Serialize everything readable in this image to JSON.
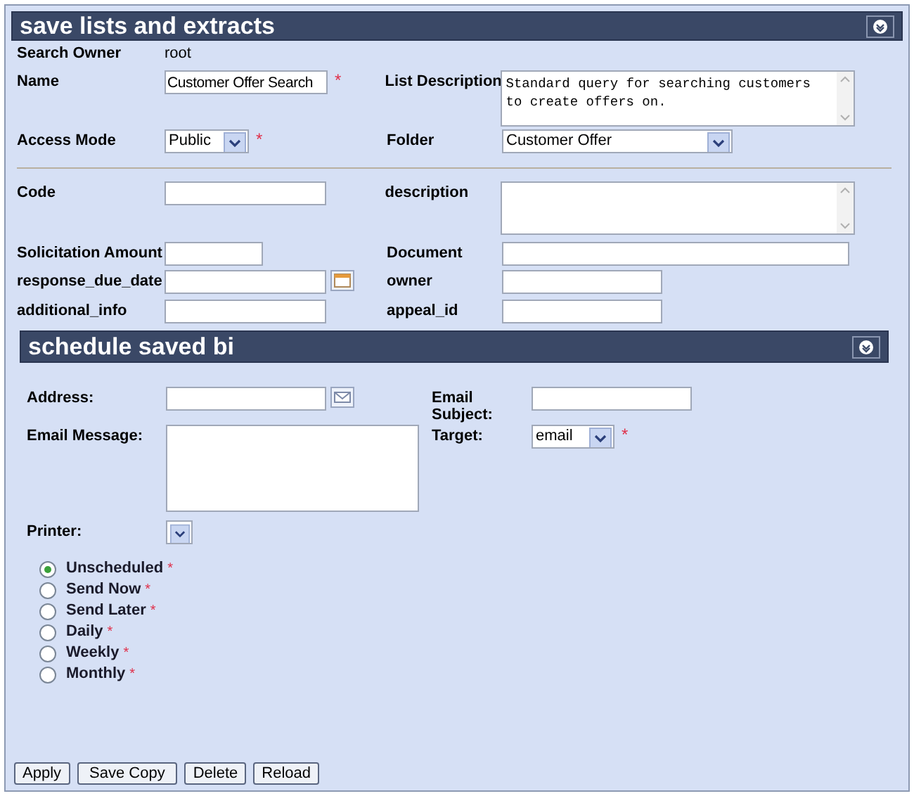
{
  "save_panel": {
    "title": "save lists and extracts",
    "owner": {
      "label": "Search Owner",
      "value": "root"
    },
    "rows": [
      {
        "left": {
          "label": "Name",
          "kind": "text",
          "value": "Customer Offer Search",
          "required_mark": "*"
        },
        "right": {
          "label": "List Description",
          "kind": "textarea",
          "value": "Standard query for searching customers to create offers on."
        }
      },
      {
        "left": {
          "label": "Access Mode",
          "kind": "select",
          "value": "Public",
          "required_mark": "*"
        },
        "right": {
          "label": "Folder",
          "kind": "select",
          "value": "Customer Offer"
        }
      },
      {
        "left": {
          "label": "Code",
          "kind": "text"
        },
        "right": {
          "label": "description",
          "kind": "textarea"
        }
      },
      {
        "left": {
          "label": "Solicitation Amount",
          "kind": "text"
        },
        "right": {
          "label": "Document",
          "kind": "text"
        }
      },
      {
        "left": {
          "label": "response_due_date",
          "kind": "date"
        },
        "right": {
          "label": "owner",
          "kind": "text"
        }
      },
      {
        "left": {
          "label": "additional_info",
          "kind": "text"
        },
        "right": {
          "label": "appeal_id",
          "kind": "text"
        }
      }
    ]
  },
  "schedule_panel": {
    "title": "schedule saved bi",
    "rows": [
      {
        "left": {
          "label": "Address:",
          "kind": "email"
        },
        "right": {
          "label": "Email Subject:",
          "kind": "text"
        }
      },
      {
        "left": {
          "label": "Email Message:",
          "kind": "textarea"
        },
        "right": {
          "label": "Target:",
          "kind": "select",
          "value": "email",
          "required_mark": "*"
        }
      },
      {
        "left": {
          "label": "Printer:",
          "kind": "select"
        }
      }
    ],
    "options": [
      {
        "label": "Unscheduled",
        "selected": true,
        "required_mark": "*"
      },
      {
        "label": "Send Now",
        "selected": false,
        "required_mark": "*"
      },
      {
        "label": "Send Later",
        "selected": false,
        "required_mark": "*"
      },
      {
        "label": "Daily",
        "selected": false,
        "required_mark": "*"
      },
      {
        "label": "Weekly",
        "selected": false,
        "required_mark": "*"
      },
      {
        "label": "Monthly",
        "selected": false,
        "required_mark": "*"
      }
    ]
  },
  "buttons": [
    "Apply",
    "Save Copy",
    "Delete",
    "Reload"
  ]
}
